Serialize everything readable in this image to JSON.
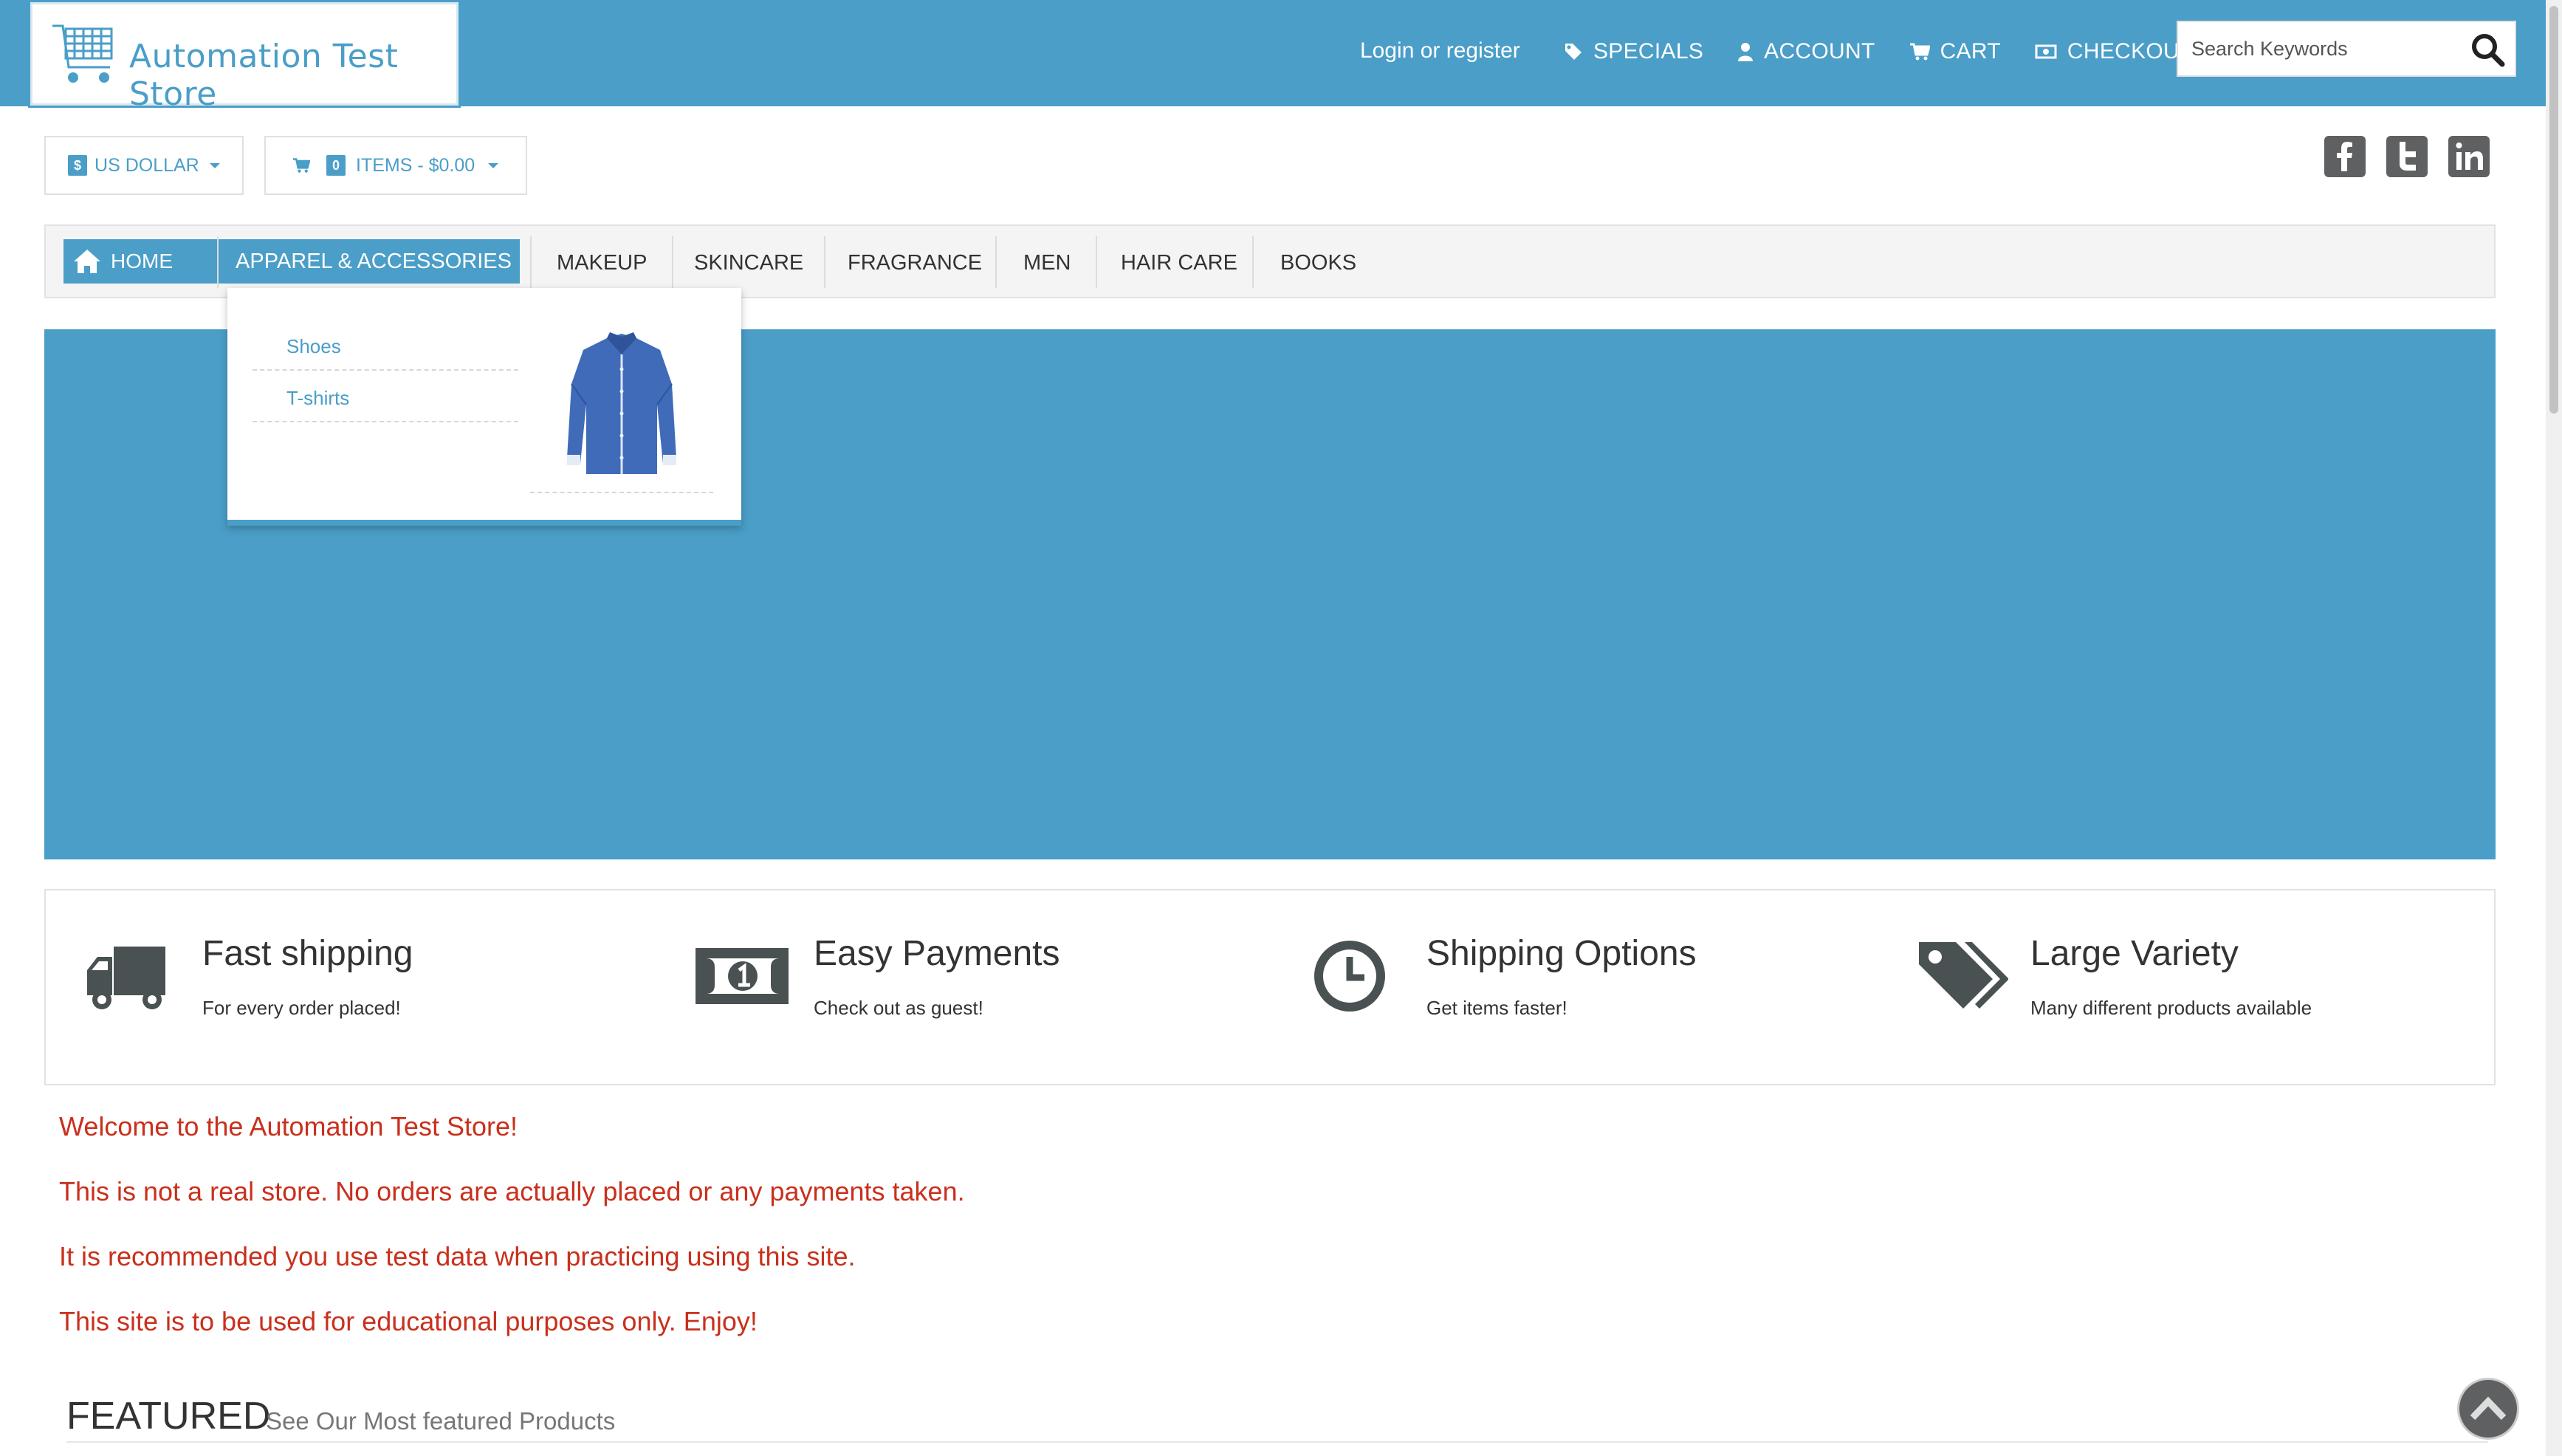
{
  "store": {
    "name": "Automation Test Store"
  },
  "header": {
    "login_label": "Login or register",
    "nav": [
      {
        "label": "SPECIALS",
        "icon": "tag-icon"
      },
      {
        "label": "ACCOUNT",
        "icon": "user-icon"
      },
      {
        "label": "CART",
        "icon": "cart-icon"
      },
      {
        "label": "CHECKOUT",
        "icon": "money-icon"
      }
    ],
    "search": {
      "placeholder": "Search Keywords",
      "value": ""
    }
  },
  "currency": {
    "symbol": "$",
    "label": "US DOLLAR"
  },
  "cart_summary": {
    "count": "0",
    "label": "ITEMS - $0.00"
  },
  "social": [
    "facebook-icon",
    "twitter-icon",
    "linkedin-icon"
  ],
  "menu": {
    "home": "HOME",
    "items": [
      "APPAREL & ACCESSORIES",
      "MAKEUP",
      "SKINCARE",
      "FRAGRANCE",
      "MEN",
      "HAIR CARE",
      "BOOKS"
    ],
    "active": "APPAREL & ACCESSORIES",
    "dropdown": {
      "links": [
        "Shoes",
        "T-shirts"
      ],
      "image": "shirt-image"
    }
  },
  "features": [
    {
      "title": "Fast shipping",
      "subtitle": "For every order placed!",
      "icon": "truck-icon"
    },
    {
      "title": "Easy Payments",
      "subtitle": "Check out as guest!",
      "icon": "money-bill-icon"
    },
    {
      "title": "Shipping Options",
      "subtitle": "Get items faster!",
      "icon": "clock-icon"
    },
    {
      "title": "Large Variety",
      "subtitle": "Many different products available",
      "icon": "tags-icon"
    }
  ],
  "welcome": [
    "Welcome to the Automation Test Store!",
    "This is not a real store. No orders are actually placed or any payments taken.",
    "It is recommended you use test data when practicing using this site.",
    "This site is to be used for educational purposes only. Enjoy!"
  ],
  "featured": {
    "title": "FEATURED",
    "subtitle": "See Our Most featured Products"
  },
  "colors": {
    "brand": "#4a9ec8",
    "text_alert": "#c9301c",
    "icon_dark": "#5e6061"
  }
}
